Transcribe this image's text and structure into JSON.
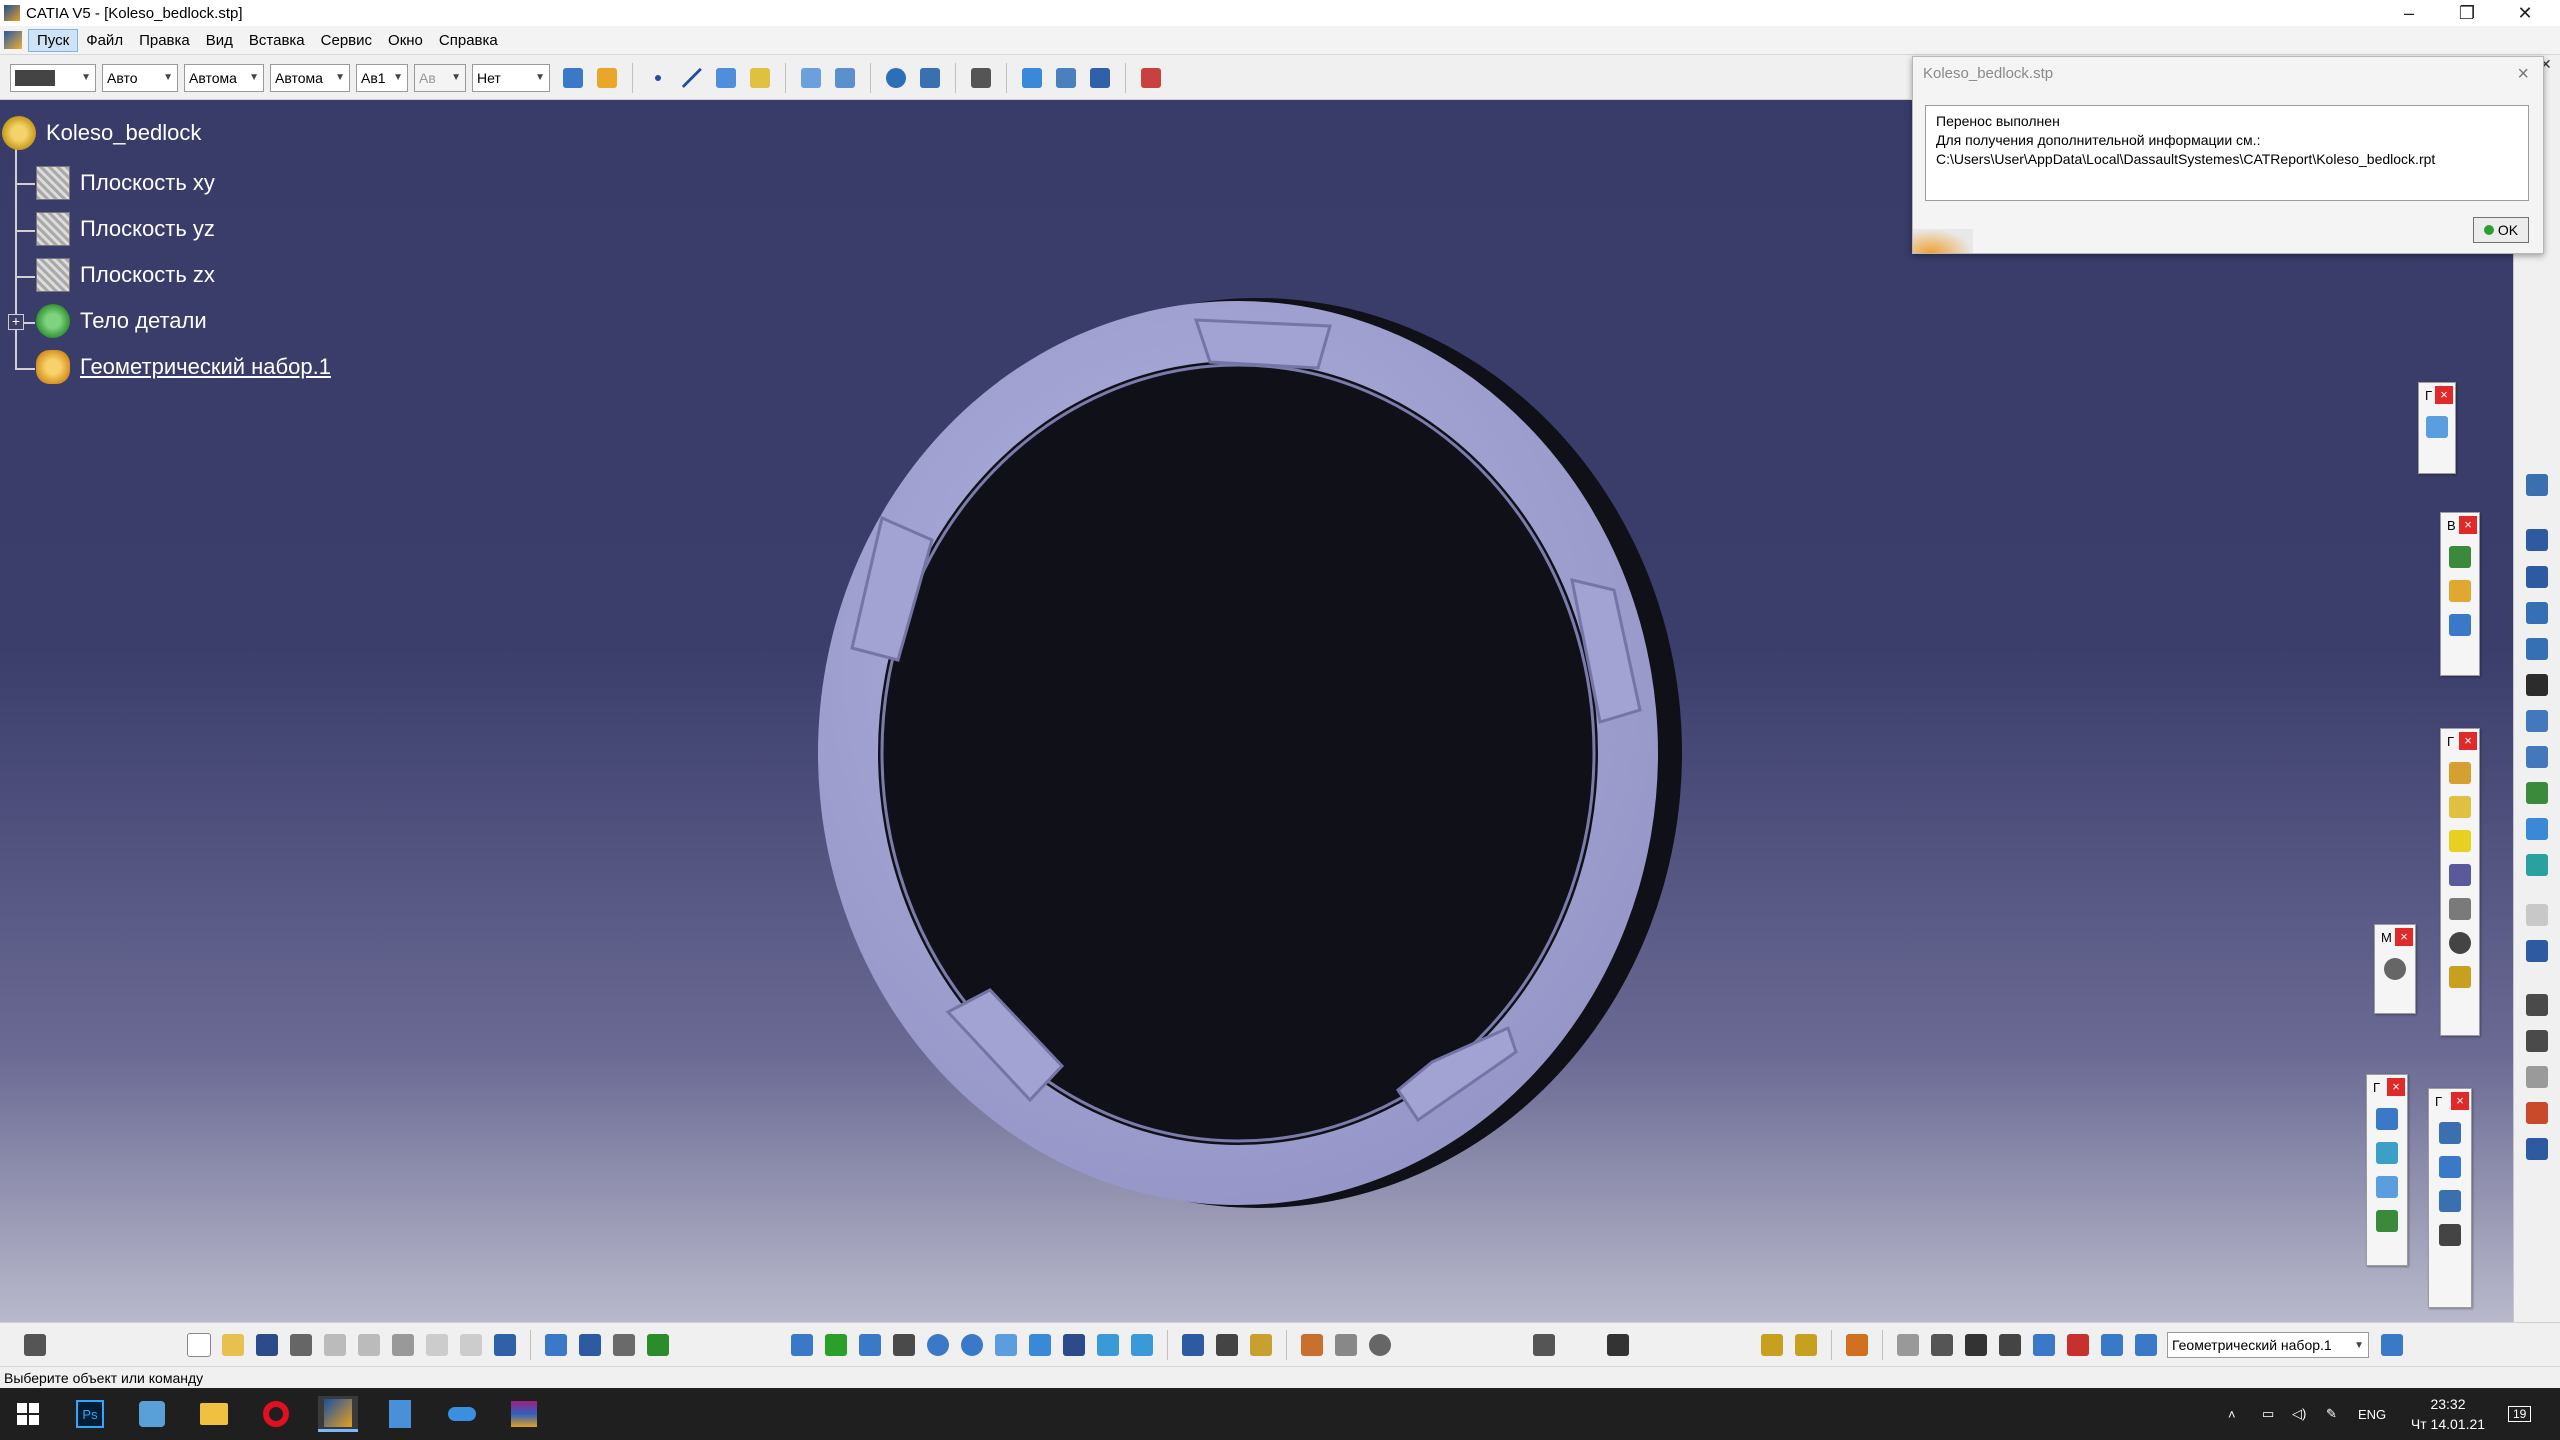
{
  "window": {
    "title": "CATIA V5 - [Koleso_bedlock.stp]",
    "minimize": "–",
    "maximize": "❐",
    "close": "✕"
  },
  "menu": {
    "items": [
      "Пуск",
      "Файл",
      "Правка",
      "Вид",
      "Вставка",
      "Сервис",
      "Окно",
      "Справка"
    ],
    "mdi_min": "–",
    "mdi_max": "❐",
    "mdi_close": "✕"
  },
  "toolbar_top": {
    "color_combo": "",
    "line_type": "Авто",
    "thickness": "Автомa",
    "linetype2": "Автомa",
    "layer": "Ав1",
    "layer2": "Ав",
    "render": "Нет"
  },
  "tree": {
    "root": "Koleso_bedlock",
    "items": [
      "Плоскость xy",
      "Плоскость yz",
      "Плоскость zx",
      "Тело детали",
      "Геометрический набор.1"
    ]
  },
  "dialog": {
    "title": "Koleso_bedlock.stp",
    "line1": "Перенос выполнен",
    "line2": "Для получения дополнительной информации см.:",
    "line3": "C:\\Users\\User\\AppData\\Local\\DassaultSystemes\\CATReport\\Koleso_bedlock.rpt",
    "ok": "OK"
  },
  "palettes": {
    "p1": "Г",
    "p2": "В",
    "p3": "Г",
    "p4": "М",
    "p5": "Г",
    "p6": "Г"
  },
  "bottom_toolbar": {
    "geoset_combo": "Геометрический набор.1"
  },
  "status": {
    "prompt": "Выберите объект или команду"
  },
  "taskbar": {
    "lang": "ENG",
    "time": "23:32",
    "date": "Чт 14.01.21",
    "notify_count": "19"
  },
  "colors": {
    "viewport_top": "#393b69",
    "viewport_bottom": "#b9b9cc",
    "part": "#a3a4d6"
  }
}
